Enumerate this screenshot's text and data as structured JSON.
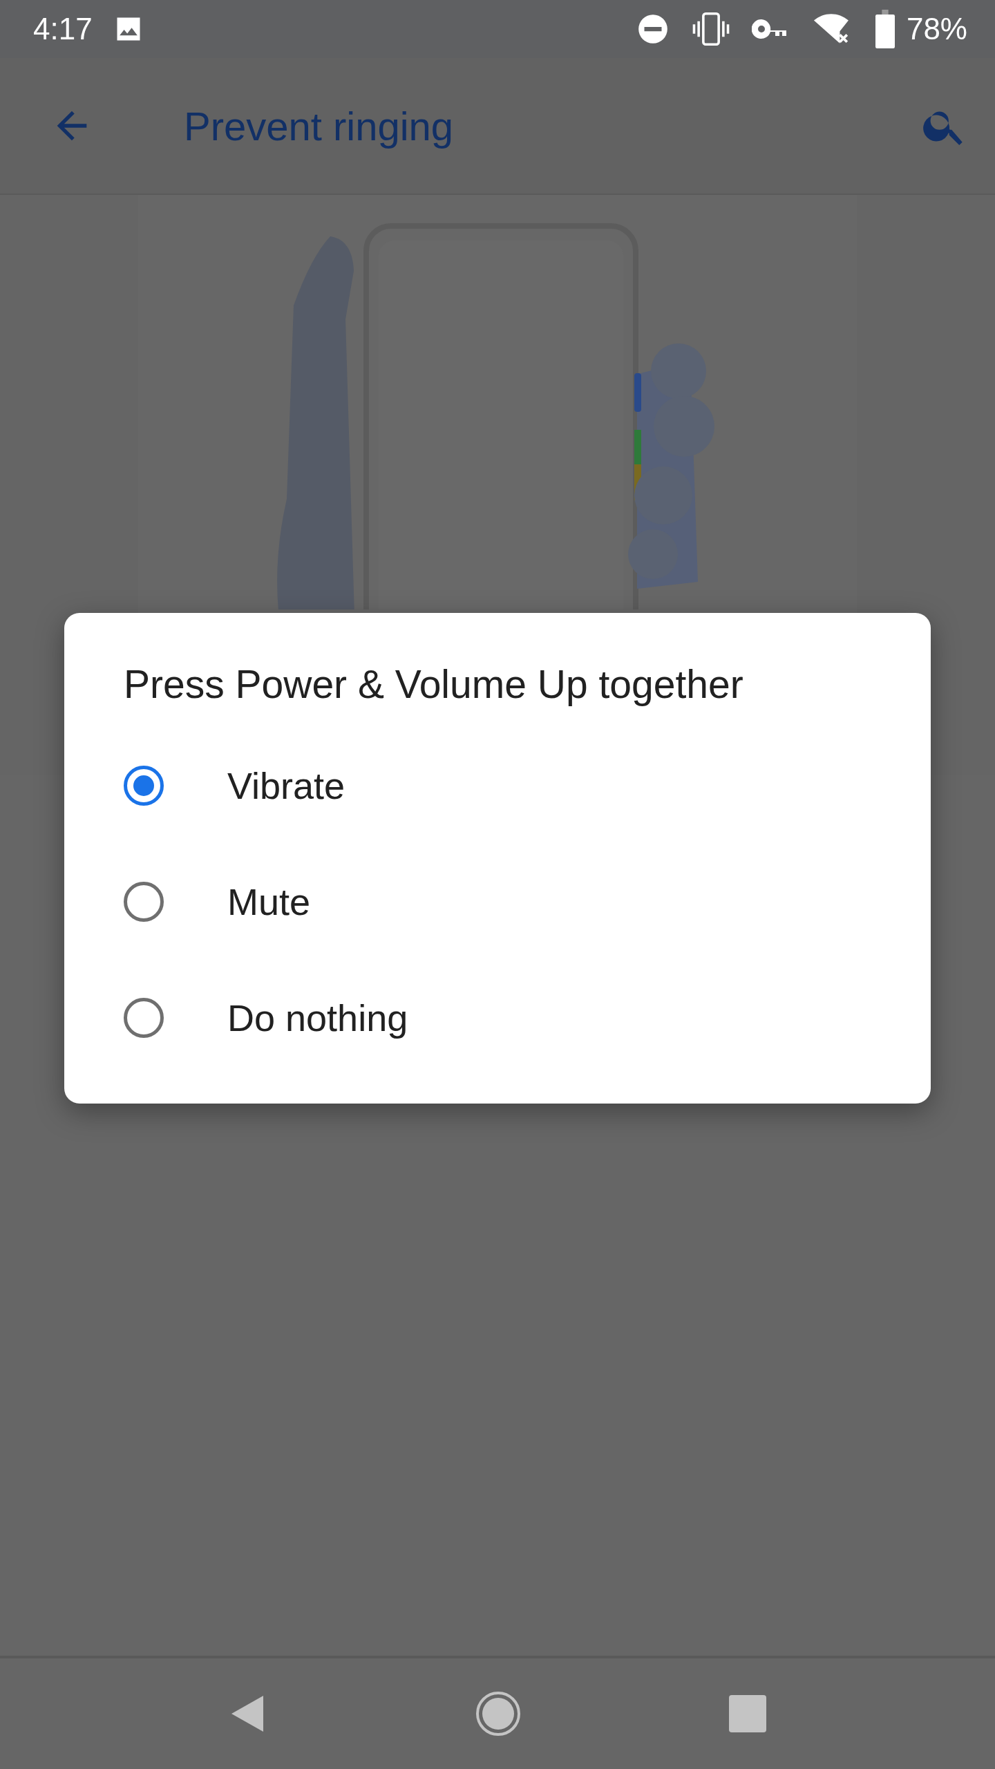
{
  "status_bar": {
    "time": "4:17",
    "battery": "78%"
  },
  "app_bar": {
    "title": "Prevent ringing"
  },
  "dialog": {
    "title": "Press Power & Volume Up together",
    "options": [
      {
        "label": "Vibrate",
        "selected": true
      },
      {
        "label": "Mute",
        "selected": false
      },
      {
        "label": "Do nothing",
        "selected": false
      }
    ]
  }
}
